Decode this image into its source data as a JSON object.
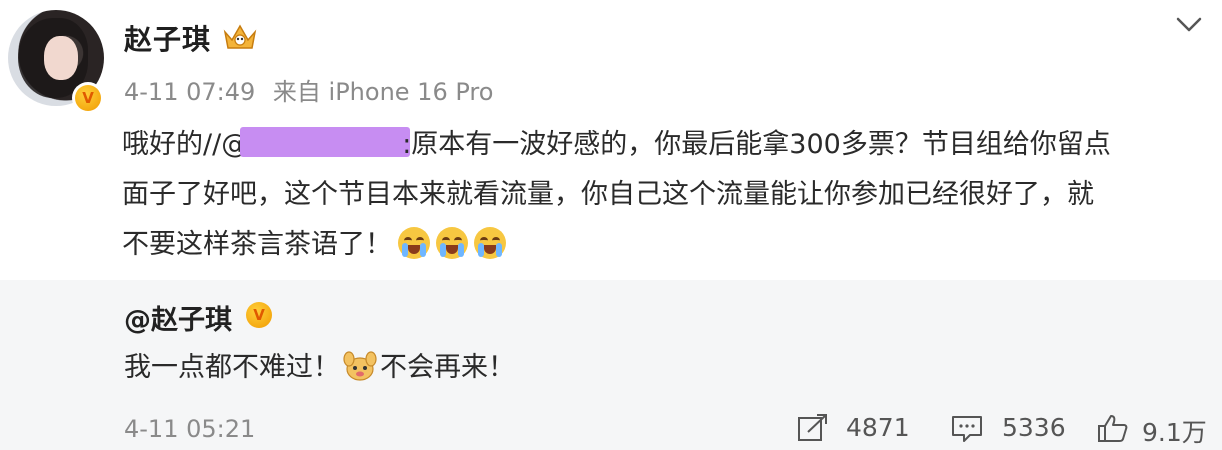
{
  "post": {
    "username": "赵子琪",
    "timestamp": "4-11 07:49",
    "source": "来自 iPhone 16 Pro",
    "line1_prefix": "哦好的//@",
    "line1_rest": ":原本有一波好感的，你最后能拿300多票？节目组给你留点",
    "line2": "面子了好吧，这个节目本来就看流量，你自己这个流量能让你参加已经很好了，就",
    "line3": "不要这样茶言茶语了！"
  },
  "quoted": {
    "username": "@赵子琪",
    "text_before": "我一点都不难过！",
    "text_after": "不会再来！",
    "timestamp": "4-11 05:21"
  },
  "actions": {
    "repost_count": "4871",
    "comment_count": "5336",
    "like_count": "9.1万"
  },
  "icons": {
    "verified": "verified-badge-icon",
    "crown": "crown-badge-icon",
    "chevron": "chevron-down-icon",
    "repost": "repost-icon",
    "comment": "comment-icon",
    "like": "like-icon"
  },
  "colors": {
    "redaction": "#c78df2",
    "verified": "#f09a00",
    "quote_bg": "#f5f6f7"
  }
}
